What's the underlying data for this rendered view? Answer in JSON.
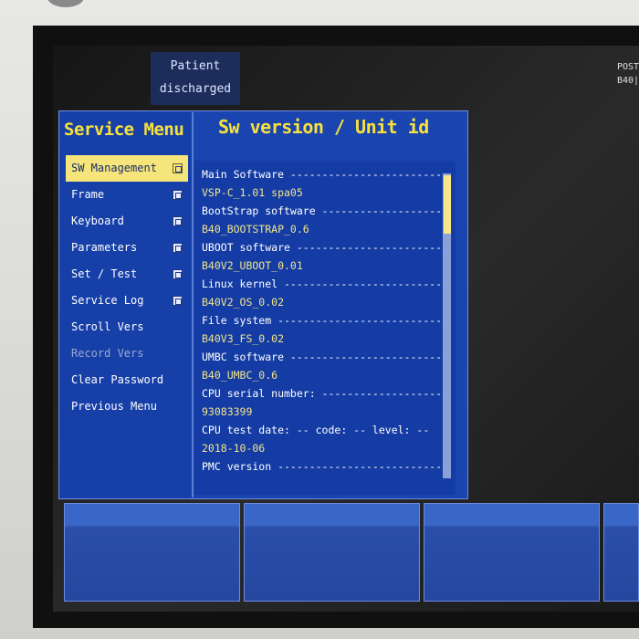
{
  "status": {
    "line1": "Patient",
    "line2": "discharged"
  },
  "corner": {
    "line1": "POST",
    "line2": "B40|"
  },
  "menu": {
    "title": "Service Menu",
    "items": [
      {
        "label": "SW Management"
      },
      {
        "label": "Frame"
      },
      {
        "label": "Keyboard"
      },
      {
        "label": "Parameters"
      },
      {
        "label": "Set / Test"
      },
      {
        "label": "Service Log"
      },
      {
        "label": "Scroll Vers"
      },
      {
        "label": "Record Vers"
      },
      {
        "label": "Clear Password"
      },
      {
        "label": "Previous Menu"
      }
    ]
  },
  "content": {
    "title": "Sw version / Unit id",
    "lines": [
      "Main Software ---------------------------",
      "VSP-C_1.01 spa05",
      "BootStrap software ---------------------",
      "B40_BOOTSTRAP_0.6",
      "UBOOT software -------------------------",
      "B40V2_UBOOT_0.01",
      "Linux kernel ---------------------------",
      "B40V2_OS_0.02",
      "File system ----------------------------",
      "B40V3_FS_0.02",
      "UMBC software --------------------------",
      "B40_UMBC_0.6",
      "CPU serial number: --------------------",
      "93083399",
      "CPU test date: -- code: -- level: --",
      "2018-10-06",
      "PMC version ----------------------------"
    ]
  }
}
